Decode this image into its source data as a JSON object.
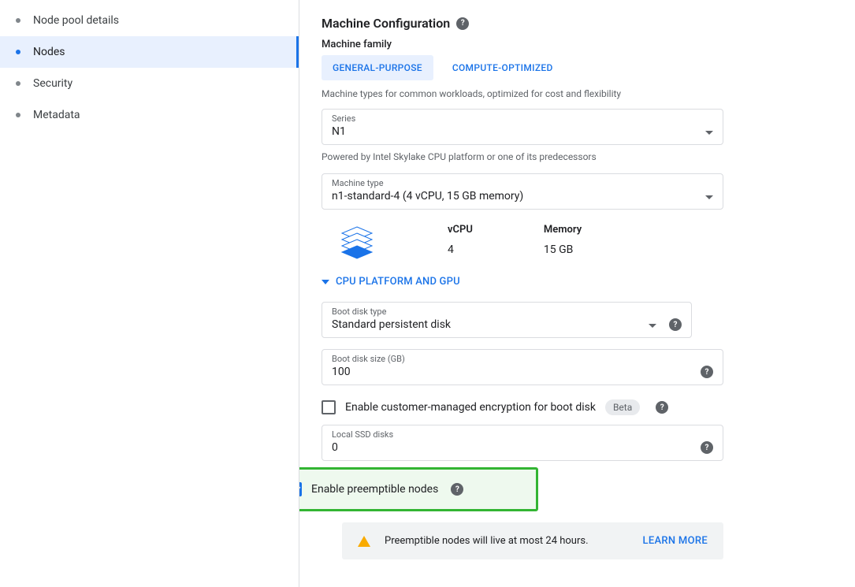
{
  "sidebar": {
    "items": [
      {
        "label": "Node pool details",
        "active": false
      },
      {
        "label": "Nodes",
        "active": true
      },
      {
        "label": "Security",
        "active": false
      },
      {
        "label": "Metadata",
        "active": false
      }
    ]
  },
  "section": {
    "title": "Machine Configuration",
    "family_label": "Machine family",
    "tabs": [
      {
        "label": "GENERAL-PURPOSE",
        "active": true
      },
      {
        "label": "COMPUTE-OPTIMIZED",
        "active": false
      }
    ],
    "family_hint": "Machine types for common workloads, optimized for cost and flexibility",
    "series": {
      "label": "Series",
      "value": "N1"
    },
    "series_hint": "Powered by Intel Skylake CPU platform or one of its predecessors",
    "machine_type": {
      "label": "Machine type",
      "value": "n1-standard-4 (4 vCPU, 15 GB memory)"
    },
    "summary": {
      "vcpu_label": "vCPU",
      "vcpu_value": "4",
      "mem_label": "Memory",
      "mem_value": "15 GB"
    },
    "expander_label": "CPU PLATFORM AND GPU",
    "boot_disk_type": {
      "label": "Boot disk type",
      "value": "Standard persistent disk"
    },
    "boot_disk_size": {
      "label": "Boot disk size (GB)",
      "value": "100"
    },
    "cmek": {
      "label": "Enable customer-managed encryption for boot disk",
      "badge": "Beta"
    },
    "local_ssd": {
      "label": "Local SSD disks",
      "value": "0"
    },
    "preemptible": {
      "label": "Enable preemptible nodes"
    },
    "info": {
      "text": "Preemptible nodes will live at most 24 hours.",
      "action": "LEARN MORE"
    }
  }
}
